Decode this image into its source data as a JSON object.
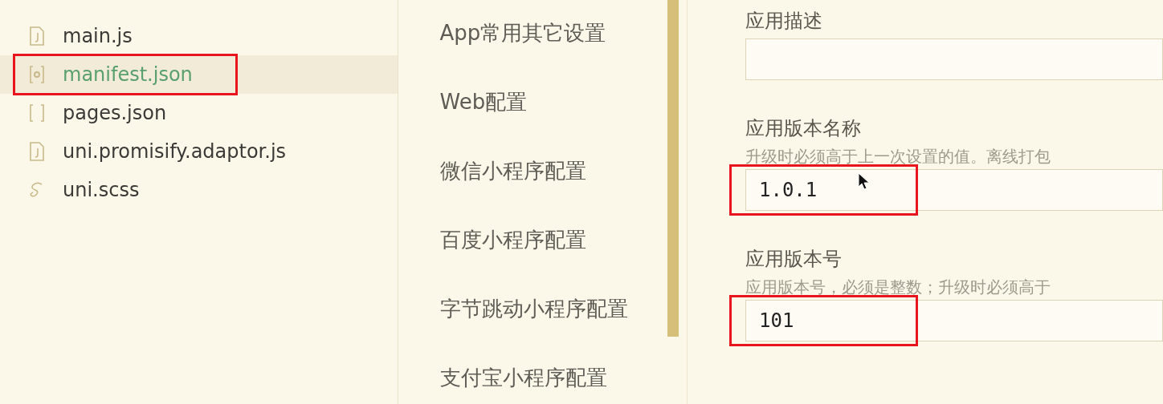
{
  "file_tree": {
    "items": [
      {
        "name": "main.js",
        "kind": "js",
        "selected": false,
        "highlighted": false
      },
      {
        "name": "manifest.json",
        "kind": "manifest",
        "selected": true,
        "highlighted": true
      },
      {
        "name": "pages.json",
        "kind": "json",
        "selected": false,
        "highlighted": false
      },
      {
        "name": "uni.promisify.adaptor.js",
        "kind": "js",
        "selected": false,
        "highlighted": false
      },
      {
        "name": "uni.scss",
        "kind": "scss",
        "selected": false,
        "highlighted": false
      }
    ]
  },
  "settings_nav": {
    "items": [
      "App常用其它设置",
      "Web配置",
      "微信小程序配置",
      "百度小程序配置",
      "字节跳动小程序配置",
      "支付宝小程序配置"
    ]
  },
  "form": {
    "fields": [
      {
        "label": "应用描述",
        "highlighted": false
      },
      {
        "label": "应用版本名称",
        "hint": "升级时必须高于上一次设置的值。离线打包",
        "value": "1.0.1",
        "highlighted": true
      },
      {
        "label": "应用版本号",
        "hint": "应用版本号，必须是整数；升级时必须高于",
        "value": "101",
        "highlighted": true
      }
    ]
  }
}
